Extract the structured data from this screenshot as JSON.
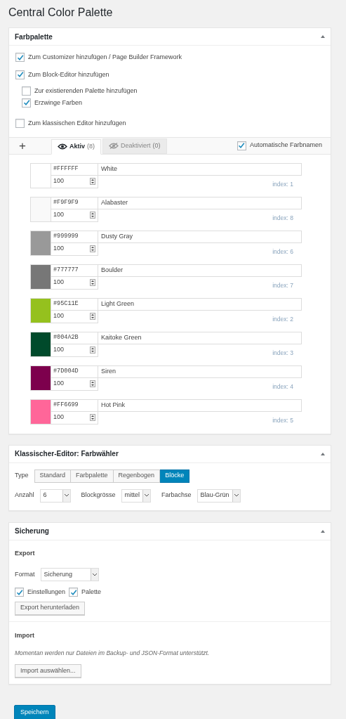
{
  "page_title": "Central Color Palette",
  "palette_panel": {
    "title": "Farbpalette",
    "options": [
      {
        "label": "Zum Customizer hinzufügen / Page Builder Framework",
        "checked": true
      },
      {
        "label": "Zum Block-Editor hinzufügen",
        "checked": true,
        "children": [
          {
            "label": "Zur existierenden Palette hinzufügen",
            "checked": false
          },
          {
            "label": "Erzwinge Farben",
            "checked": true
          }
        ]
      },
      {
        "label": "Zum klassischen Editor hinzufügen",
        "checked": false
      }
    ],
    "add_button": "+",
    "tabs": [
      {
        "label": "Aktiv",
        "count": "(8)",
        "kind": "eye",
        "selected": true
      },
      {
        "label": "Deaktiviert",
        "count": "(0)",
        "kind": "eye-off",
        "selected": false
      }
    ],
    "auto_names": {
      "label": "Automatische Farbnamen",
      "checked": true
    },
    "colors": [
      {
        "hex": "#FFFFFF",
        "name": "White",
        "opacity": "100",
        "index": "index: 1",
        "color": "#ffffff"
      },
      {
        "hex": "#F9F9F9",
        "name": "Alabaster",
        "opacity": "100",
        "index": "index: 8",
        "color": "#f9f9f9"
      },
      {
        "hex": "#999999",
        "name": "Dusty Gray",
        "opacity": "100",
        "index": "index: 6",
        "color": "#999999"
      },
      {
        "hex": "#777777",
        "name": "Boulder",
        "opacity": "100",
        "index": "index: 7",
        "color": "#777777"
      },
      {
        "hex": "#95C11E",
        "name": "Light Green",
        "opacity": "100",
        "index": "index: 2",
        "color": "#95c11e"
      },
      {
        "hex": "#004A2B",
        "name": "Kaitoke Green",
        "opacity": "100",
        "index": "index: 3",
        "color": "#004a2b"
      },
      {
        "hex": "#7D004D",
        "name": "Siren",
        "opacity": "100",
        "index": "index: 4",
        "color": "#7d004d"
      },
      {
        "hex": "#FF6699",
        "name": "Hot Pink",
        "opacity": "100",
        "index": "index: 5",
        "color": "#ff6699"
      }
    ]
  },
  "picker_panel": {
    "title": "Klassischer-Editor: Farbwähler",
    "type_label": "Type",
    "types": [
      {
        "label": "Standard",
        "selected": false
      },
      {
        "label": "Farbpalette",
        "selected": false
      },
      {
        "label": "Regenbogen",
        "selected": false
      },
      {
        "label": "Blöcke",
        "selected": true
      }
    ],
    "selects": [
      {
        "label": "Anzahl",
        "value": "6"
      },
      {
        "label": "Blockgrösse",
        "value": "mittel"
      },
      {
        "label": "Farbachse",
        "value": "Blau-Grün"
      }
    ]
  },
  "backup_panel": {
    "title": "Sicherung",
    "export_heading": "Export",
    "format_label": "Format",
    "format_value": "Sicherung",
    "export_options": [
      {
        "label": "Einstellungen",
        "checked": true
      },
      {
        "label": "Palette",
        "checked": true
      }
    ],
    "export_button": "Export herunterladen",
    "import_heading": "Import",
    "import_note": "Momentan werden nur Dateien im Backup- und JSON-Format unterstützt.",
    "import_button": "Import auswählen..."
  },
  "save_button": "Speichern"
}
